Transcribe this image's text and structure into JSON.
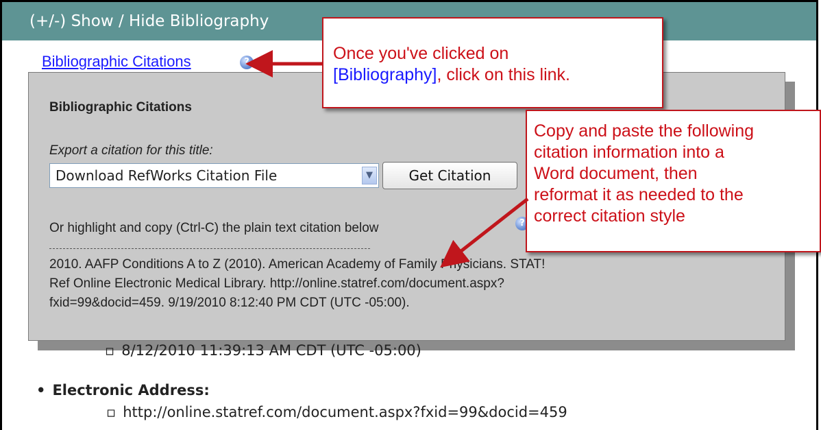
{
  "header": {
    "toggle_label": "(+/-) Show / Hide Bibliography"
  },
  "bibliography_link": {
    "label": "Bibliographic Citations",
    "help_icon": "help-icon"
  },
  "panel": {
    "title": "Bibliographic Citations",
    "export_label": "Export a citation for this title:",
    "select_value": "Download RefWorks Citation File",
    "button_label": "Get Citation",
    "highlight_text": "Or highlight and copy (Ctrl-C) the plain text citation below",
    "citation_lines": [
      "2010. AAFP Conditions A to Z (2010). American Academy of Family Physicians. STAT!",
      "Ref Online Electronic Medical Library. http://online.statref.com/document.aspx?",
      "fxid=99&docid=459. 9/19/2010 8:12:40 PM CDT (UTC -05:00)."
    ]
  },
  "details": {
    "date_value": "8/12/2010 11:39:13 AM CDT (UTC -05:00)",
    "electronic_address_label": "Electronic Address:",
    "url": "http://online.statref.com/document.aspx?fxid=99&docid=459"
  },
  "callouts": {
    "first": {
      "line1": "Once you've clicked on",
      "bracket_text": "[Bibliography]",
      "line2_rest": ", click on this link."
    },
    "second": {
      "lines": [
        "Copy and paste the following",
        "citation information into a",
        "Word document, then",
        "reformat it as needed to the",
        "correct citation style"
      ]
    }
  },
  "colors": {
    "header_bg": "#5e9494",
    "callout_red": "#cc1018",
    "link_blue": "#1a1aff",
    "panel_bg": "#c9c9c9"
  }
}
